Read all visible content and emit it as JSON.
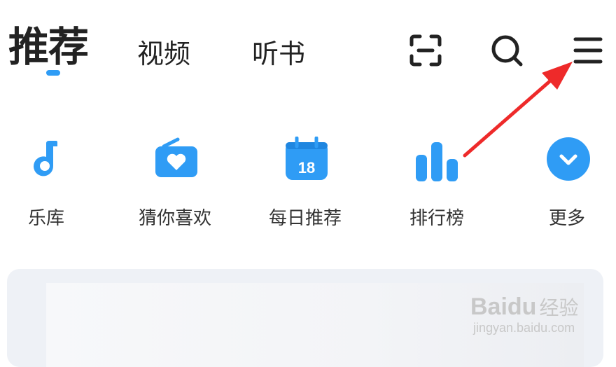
{
  "tabs": [
    {
      "label": "推荐",
      "active": true
    },
    {
      "label": "视频",
      "active": false
    },
    {
      "label": "听书",
      "active": false
    }
  ],
  "header_icons": [
    "scan-icon",
    "search-icon",
    "menu-icon"
  ],
  "shortcuts": [
    {
      "label": "乐库",
      "icon": "music-note-icon"
    },
    {
      "label": "猜你喜欢",
      "icon": "radio-heart-icon"
    },
    {
      "label": "每日推荐",
      "icon": "calendar-icon",
      "badge": "18"
    },
    {
      "label": "排行榜",
      "icon": "bar-chart-icon"
    },
    {
      "label": "更多",
      "icon": "chevron-down-icon"
    }
  ],
  "colors": {
    "accent": "#2f9cf5",
    "text": "#222222",
    "annotation": "#ee2a2a"
  },
  "watermark": {
    "logo": "Baidu",
    "logo_suffix": "经验",
    "url": "jingyan.baidu.com"
  }
}
